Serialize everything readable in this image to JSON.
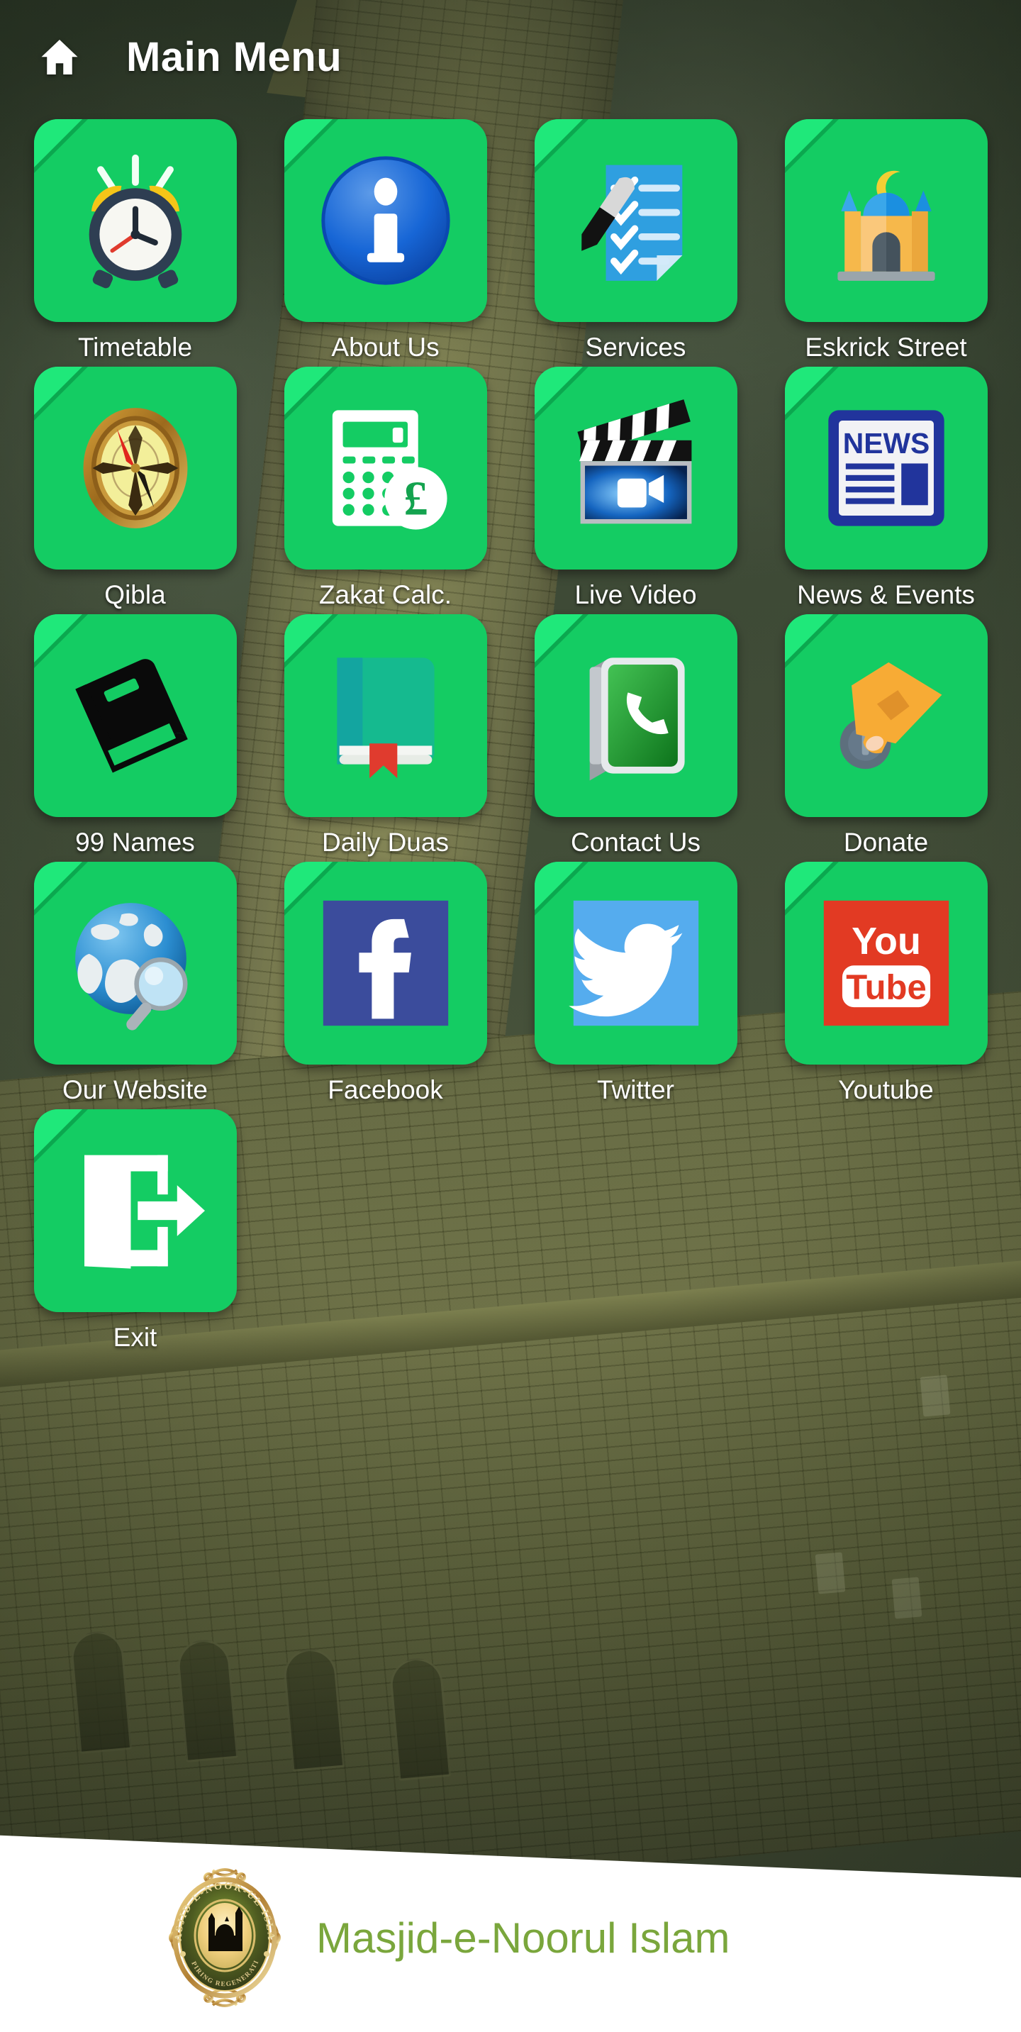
{
  "header": {
    "home_icon": "home-icon",
    "title": "Main Menu"
  },
  "colors": {
    "tile_green": "#14cc63",
    "tile_fold_light": "#1fe87a",
    "tile_fold_dark": "#0ba84f",
    "label_white": "#ffffff",
    "background_olive": "#4a553d",
    "brand_green": "#7aa63c",
    "footer_white": "#ffffff"
  },
  "menu": {
    "items": [
      {
        "label": "Timetable",
        "icon": "alarm-clock-icon"
      },
      {
        "label": "About Us",
        "icon": "info-circle-icon"
      },
      {
        "label": "Services",
        "icon": "checklist-pen-icon"
      },
      {
        "label": "Eskrick Street",
        "icon": "mosque-icon"
      },
      {
        "label": "Qibla",
        "icon": "compass-icon"
      },
      {
        "label": "Zakat Calc.",
        "icon": "calculator-pound-icon"
      },
      {
        "label": "Live Video",
        "icon": "clapperboard-video-icon"
      },
      {
        "label": "News & Events",
        "icon": "newspaper-icon"
      },
      {
        "label": "99 Names",
        "icon": "black-book-icon"
      },
      {
        "label": "Daily Duas",
        "icon": "teal-book-bookmark-icon"
      },
      {
        "label": "Contact Us",
        "icon": "phone-call-icon"
      },
      {
        "label": "Donate",
        "icon": "hand-coin-icon"
      },
      {
        "label": "Our Website",
        "icon": "globe-search-icon"
      },
      {
        "label": "Facebook",
        "icon": "facebook-icon"
      },
      {
        "label": "Twitter",
        "icon": "twitter-bird-icon"
      },
      {
        "label": "Youtube",
        "icon": "youtube-icon"
      },
      {
        "label": "Exit",
        "icon": "exit-door-icon"
      }
    ]
  },
  "footer": {
    "logo_icon": "masjid-crest-logo",
    "logo_ring_text": "MASJID-E-NOOR-UL-ISLAM",
    "logo_motto_text": "INSPIRING REGENERATION",
    "brand_name": "Masjid-e-Noorul Islam"
  }
}
